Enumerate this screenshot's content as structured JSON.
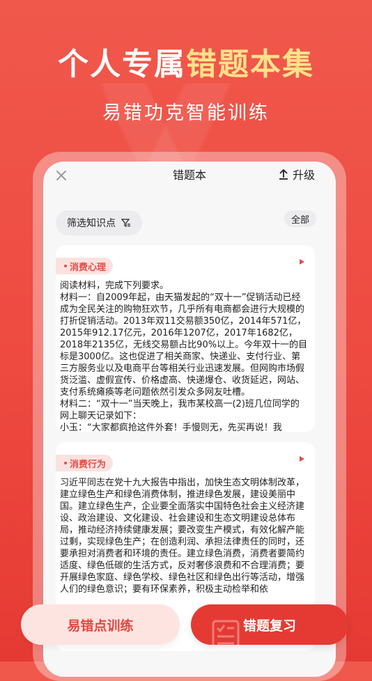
{
  "hero": {
    "title_prefix": "个人专属",
    "title_highlight": "错题本集",
    "subtitle": "易错功克智能训练"
  },
  "app": {
    "nav_title": "错题本",
    "upgrade_label": "升级",
    "filter_label": "筛选知识点",
    "all_label": "全部"
  },
  "cards": [
    {
      "tag": "消费心理",
      "text": "阅读材料，完成下列要求。\n材料一：自2009年起，由天猫发起的“双十一”促销活动已经成为全民关注的购物狂欢节，几乎所有电商都会进行大规模的打折促销活动。2013年双11交易额350亿，2014年571亿，2015年912.17亿元，2016年1207亿，2017年1682亿，2018年2135亿，无线交易额占比90%以上。今年双十一的目标是3000亿。这也促进了相关商家、快递业、支付行业、第三方服务业以及电商平台等相关行业迅速发展。但网购市场假货泛滥、虚假宣传、价格虚高、快递爆仓、收货延迟，网站、支付系统瘫痪等老问题依然引发众多网友吐槽。\n材料二：“双十一”当天晚上，我市某校高一(2)班几位同学的网上聊天记录如下：\n小玉：“大家都疯抢这件外套！手慢则无，先买再说！我"
    },
    {
      "tag": "消费行为",
      "text": "习近平同志在党十九大报告中指出，加快生态文明体制改革，建立绿色生产和绿色消费体制，推进绿色发展，建设美丽中国。建立绿色生产，企业要全面落实中国特色社会主义经济建设、政治建设、文化建设、社会建设和生态文明建设总体布局，推动经济持续健康发展；要改变生产模式，有效化解产能过剩，实现绿色生产；在创造利润、承担法律责任的同时，还要承担对消费者和环境的责任。建立绿色消费，消费者要简约适度、绿色低碳的生活方式，反对奢侈浪费和不合理消费；要开展绿色家庭、绿色学校、绿色社区和绿色出行等活动，增强人们的绿色意识；要有环保素养，积极主动检举和依"
    }
  ],
  "bottom": {
    "left_button": "易错点训练",
    "right_button": "错题复习"
  },
  "colors": {
    "brand_red": "#e53a33",
    "highlight_yellow": "#ffe18a",
    "tag_bg": "#fbe2e0"
  },
  "icons": {
    "close": "close-icon",
    "upgrade": "upload-arrow-icon",
    "filter": "funnel-icon",
    "play": "play-triangle-icon",
    "review": "checklist-icon"
  }
}
